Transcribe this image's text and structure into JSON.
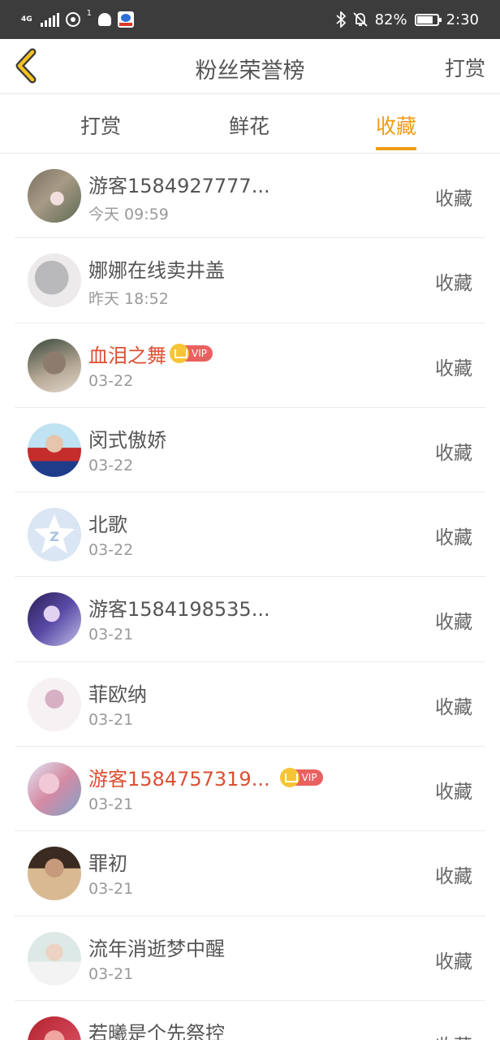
{
  "status_bar": {
    "network": "4G",
    "hotspot_count": "1",
    "battery": "82%",
    "time": "2:30"
  },
  "header": {
    "title": "粉丝荣誉榜",
    "action_label": "打赏",
    "back_icon": "chevron-left-icon"
  },
  "tabs": [
    {
      "label": "打赏",
      "active": false
    },
    {
      "label": "鲜花",
      "active": false
    },
    {
      "label": "收藏",
      "active": true
    }
  ],
  "colors": {
    "accent": "#ef9d16",
    "vip_name": "#dd4f33",
    "status_bar": "#3c3c3c"
  },
  "fans": [
    {
      "name": "游客1584927777...",
      "time": "今天 09:59",
      "action": "收藏",
      "vip": false,
      "vip_label": ""
    },
    {
      "name": "娜娜在线卖井盖",
      "time": "昨天 18:52",
      "action": "收藏",
      "vip": false,
      "vip_label": ""
    },
    {
      "name": "血泪之舞",
      "time": "03-22",
      "action": "收藏",
      "vip": true,
      "vip_label": "VIP"
    },
    {
      "name": "闵式傲娇",
      "time": "03-22",
      "action": "收藏",
      "vip": false,
      "vip_label": ""
    },
    {
      "name": "北歌",
      "time": "03-22",
      "action": "收藏",
      "vip": false,
      "vip_label": ""
    },
    {
      "name": "游客1584198535...",
      "time": "03-21",
      "action": "收藏",
      "vip": false,
      "vip_label": ""
    },
    {
      "name": "菲欧纳",
      "time": "03-21",
      "action": "收藏",
      "vip": false,
      "vip_label": ""
    },
    {
      "name": "游客1584757319...",
      "time": "03-21",
      "action": "收藏",
      "vip": true,
      "vip_label": "VIP"
    },
    {
      "name": "罪初",
      "time": "03-21",
      "action": "收藏",
      "vip": false,
      "vip_label": ""
    },
    {
      "name": "流年消逝梦中醒",
      "time": "03-21",
      "action": "收藏",
      "vip": false,
      "vip_label": ""
    },
    {
      "name": "若曦是个先祭控",
      "time": "",
      "action": "收藏",
      "vip": false,
      "vip_label": ""
    }
  ]
}
